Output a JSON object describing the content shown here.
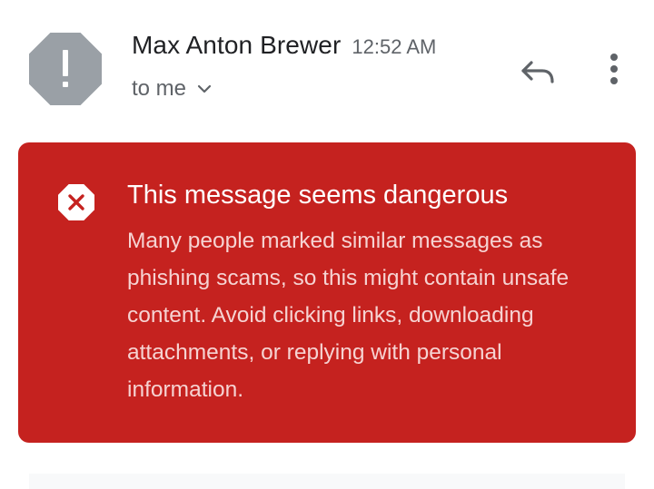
{
  "header": {
    "sender_name": "Max Anton Brewer",
    "time": "12:52 AM",
    "recipient": "to me",
    "avatar_icon": "exclamation-octagon-icon",
    "reply_icon": "reply-icon",
    "more_icon": "more-vert-icon",
    "expand_icon": "chevron-down-icon"
  },
  "warning": {
    "icon": "error-x-icon",
    "title": "This message seems dangerous",
    "body": "Many people marked similar messages as phishing scams, so this might contain unsafe content. Avoid clicking links, downloading attachments, or replying with personal information."
  },
  "colors": {
    "banner_bg": "#c5221f",
    "banner_text": "#ffffff",
    "banner_body_text": "#f6d3d2",
    "avatar_bg": "#9aa0a6",
    "icon_gray": "#5f6368"
  }
}
